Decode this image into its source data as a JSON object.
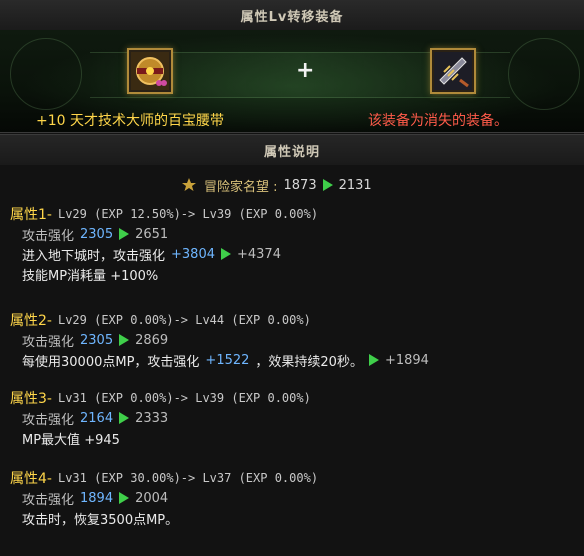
{
  "window": {
    "title": "属性Lv转移装备"
  },
  "transfer": {
    "source_item_name": "+10 天才技术大师的百宝腰带",
    "plus_symbol": "+",
    "lost_note": "该装备为消失的装备。",
    "source_icon": "belt-icon",
    "target_icon": "claw-weapon-icon"
  },
  "section": {
    "title": "属性说明"
  },
  "fame": {
    "label": "冒险家名望 :",
    "from": "1873",
    "to": "2131"
  },
  "attributes": [
    {
      "name": "属性1-",
      "level_text": "Lv29 (EXP 12.50%)-> Lv39 (EXP 0.00%)",
      "stat_label": "攻击强化",
      "stat_from": "2305",
      "stat_to": "2651",
      "extra1_text": "进入地下城时，攻击强化",
      "extra1_from": "+3804",
      "extra1_to": "+4374",
      "extra2_text": "技能MP消耗量 +100%"
    },
    {
      "name": "属性2-",
      "level_text": "Lv29 (EXP 0.00%)-> Lv44 (EXP 0.00%)",
      "stat_label": "攻击强化",
      "stat_from": "2305",
      "stat_to": "2869",
      "extra1_text": "每使用30000点MP，攻击强化",
      "extra1_from": "+1522",
      "extra1_mid": "，效果持续20秒。",
      "extra1_to": "+1894"
    },
    {
      "name": "属性3-",
      "level_text": "Lv31 (EXP 0.00%)-> Lv39 (EXP 0.00%)",
      "stat_label": "攻击强化",
      "stat_from": "2164",
      "stat_to": "2333",
      "extra1_text": "MP最大值 +945"
    },
    {
      "name": "属性4-",
      "level_text": "Lv31 (EXP 30.00%)-> Lv37 (EXP 0.00%)",
      "stat_label": "攻击强化",
      "stat_from": "1894",
      "stat_to": "2004",
      "extra1_text": "攻击时，恢复3500点MP。"
    }
  ],
  "colors": {
    "gold": "#ffd64a",
    "red_note": "#ff5b4a",
    "arrow_green": "#3fcf4a",
    "value_blue": "#6fb6ff"
  }
}
